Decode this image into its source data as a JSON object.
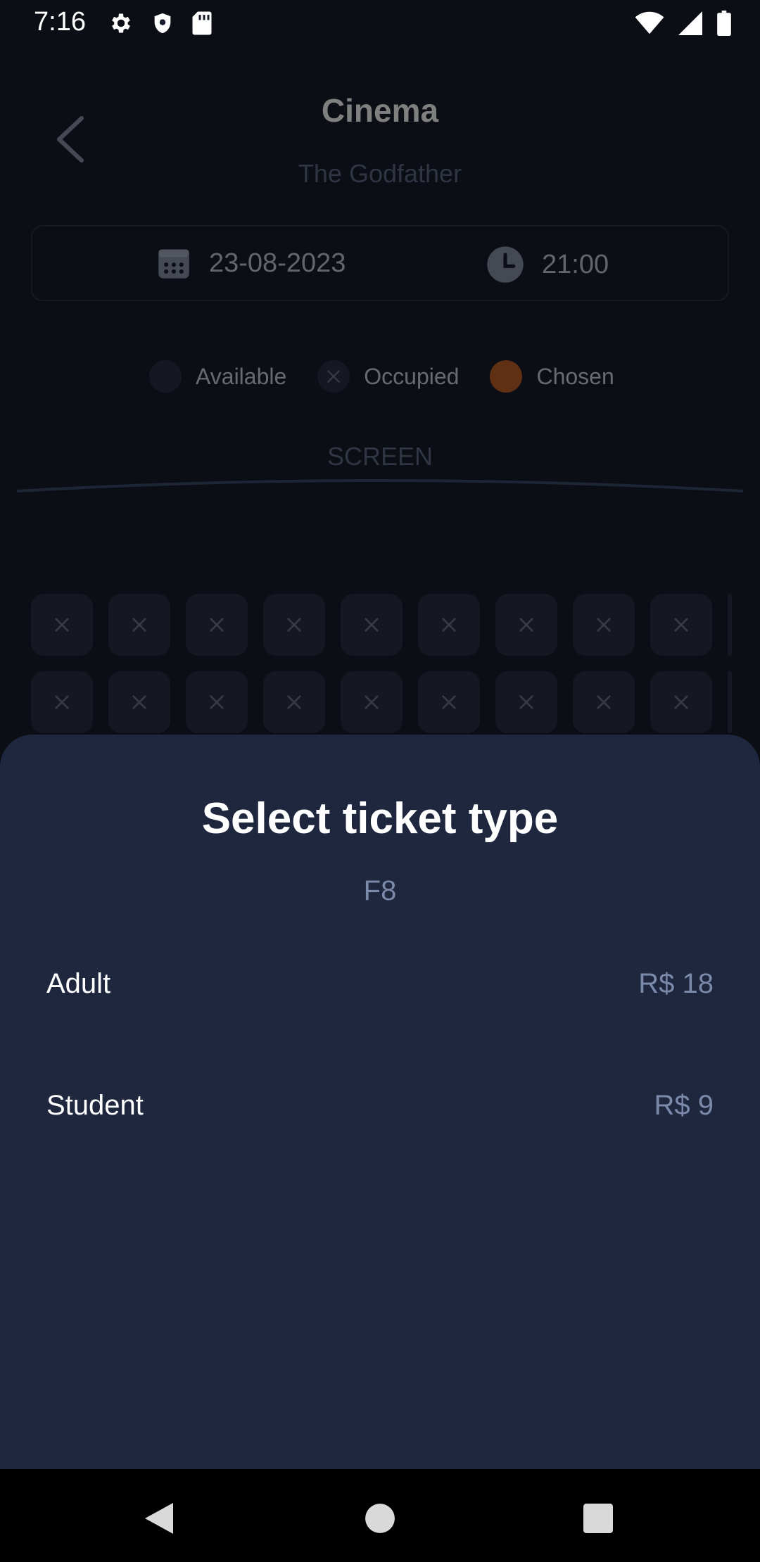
{
  "status_bar": {
    "time": "7:16",
    "left_icons": [
      "gear-icon",
      "shield-icon",
      "sd-card-icon"
    ],
    "right_icons": [
      "wifi-icon",
      "signal-icon",
      "battery-icon"
    ]
  },
  "header": {
    "title": "Cinema",
    "movie": "The Godfather"
  },
  "session": {
    "date": "23-08-2023",
    "time": "21:00"
  },
  "legend": {
    "available": "Available",
    "occupied": "Occupied",
    "chosen": "Chosen"
  },
  "screen_label": "SCREEN",
  "seats": {
    "visible_rows": 2,
    "visible_columns": 9,
    "state": "occupied"
  },
  "sheet": {
    "title": "Select ticket type",
    "seat": "F8",
    "options": [
      {
        "label": "Adult",
        "price": "R$ 18"
      },
      {
        "label": "Student",
        "price": "R$ 9"
      }
    ]
  },
  "colors": {
    "background": "#181d2b",
    "sheet": "#1e273d",
    "chosen": "#c0612a",
    "seat": "#2a3144",
    "muted_text": "#7b8aab"
  },
  "nav_bar": {
    "buttons": [
      "back-icon",
      "home-icon",
      "recents-icon"
    ]
  }
}
